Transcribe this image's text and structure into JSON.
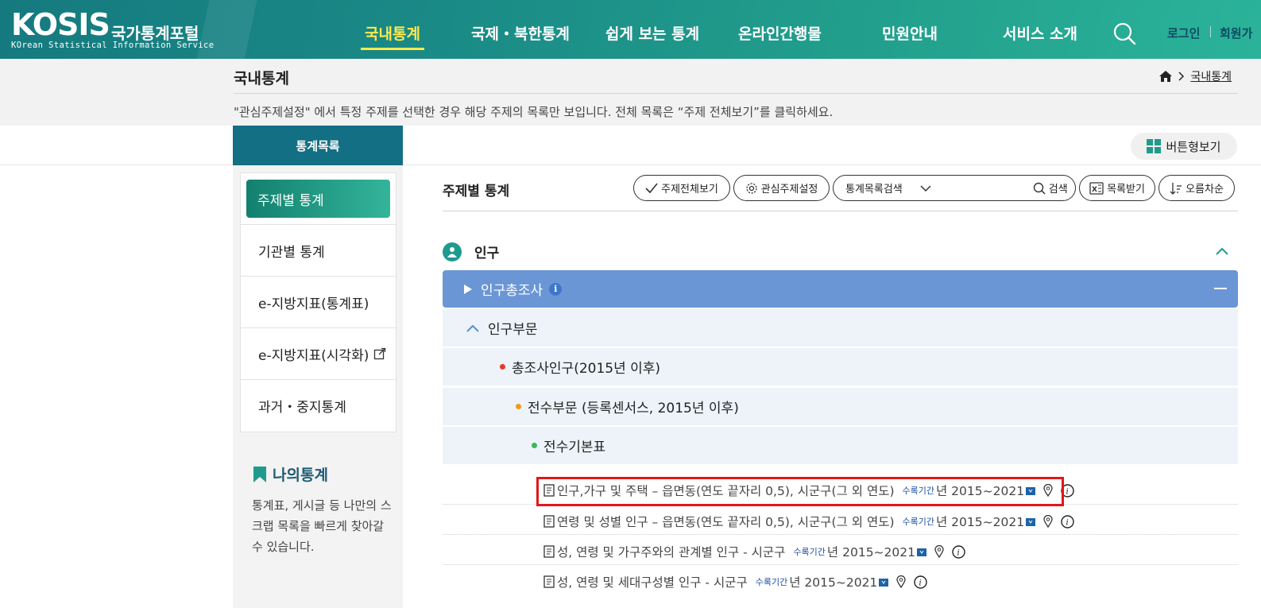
{
  "header": {
    "logo_mark": "KOSIS",
    "logo_kname": "국가통계포털",
    "logo_sub": "KOrean Statistical Information Service",
    "nav": [
      "국내통계",
      "국제・북한통계",
      "쉽게 보는 통계",
      "온라인간행물",
      "민원안내",
      "서비스 소개"
    ],
    "login": "로그인",
    "join": "회원가"
  },
  "band": {
    "title": "국내통계",
    "breadcrumb_current": "국내통계",
    "notice": "\"관심주제설정\" 에서 특정 주제를 선택한 경우 해당 주제의 목록만 보입니다. 전체 목록은 “주제 전체보기”를 클릭하세요."
  },
  "sidebar": {
    "head": "통계목록",
    "items": [
      "주제별 통계",
      "기관별 통계",
      "e-지방지표(통계표)",
      "e-지방지표(시각화)",
      "과거・중지통계"
    ],
    "mystat_title": "나의통계",
    "mystat_desc": "통계표, 게시글 등 나만의 스크랩 목록을 빠르게 찾아갈 수 있습니다."
  },
  "toolbar": {
    "view_button": "버튼형보기",
    "section_title": "주제별 통계",
    "all_topics": "주제전체보기",
    "interest": "관심주제설정",
    "search_select": "통계목록검색",
    "search": "검색",
    "download": "목록받기",
    "sort": "오름차순"
  },
  "tree": {
    "category": "인구",
    "level1": "인구총조사",
    "level2": "인구부문",
    "level3": "총조사인구(2015년 이후)",
    "level4": "전수부문 (등록센서스, 2015년 이후)",
    "level5": "전수기본표",
    "tables": [
      {
        "name": "인구,가구 및 주택 – 읍면동(연도 끝자리 0,5), 시군구(그 외 연도)",
        "period_label": "수록기간",
        "period": "년 2015~2021"
      },
      {
        "name": "연령 및 성별 인구 – 읍면동(연도 끝자리 0,5), 시군구(그 외 연도)",
        "period_label": "수록기간",
        "period": "년 2015~2021"
      },
      {
        "name": "성, 연령 및 가구주와의 관계별 인구 - 시군구",
        "period_label": "수록기간",
        "period": "년 2015~2021"
      },
      {
        "name": "성, 연령 및 세대구성별 인구 - 시군구",
        "period_label": "수록기간",
        "period": "년 2015~2021"
      }
    ]
  },
  "colors": {
    "header_teal": "#1a8a86",
    "nav_active": "#ffe94a",
    "level1_blue": "#6b96d6",
    "highlight_red": "#e01818"
  }
}
